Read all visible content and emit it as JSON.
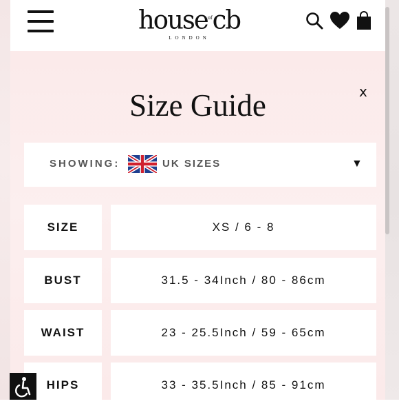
{
  "header": {
    "logo_main": "house",
    "logo_of": "of",
    "logo_end": "cb",
    "logo_sub": "LONDON",
    "icons": [
      "menu-icon",
      "search-icon",
      "heart-icon",
      "shopping-bag-icon"
    ]
  },
  "size_guide": {
    "title": "Size Guide",
    "close_label": "x",
    "showing_label": "SHOWING:",
    "flag_icon": "uk-flag-icon",
    "selected_region": "UK SIZES",
    "dropdown_icon": "▼",
    "rows": [
      {
        "label": "SIZE",
        "value": "XS / 6 - 8"
      },
      {
        "label": "BUST",
        "value": "31.5 - 34Inch / 80 - 86cm"
      },
      {
        "label": "WAIST",
        "value": "23 - 25.5Inch / 59 - 65cm"
      },
      {
        "label": "HIPS",
        "value": "33 - 35.5Inch / 85 - 91cm"
      }
    ]
  },
  "accessibility": {
    "icon": "accessibility-icon"
  },
  "colors": {
    "panel_bg": "#fbeaea",
    "text": "#111111",
    "muted": "#555555"
  }
}
